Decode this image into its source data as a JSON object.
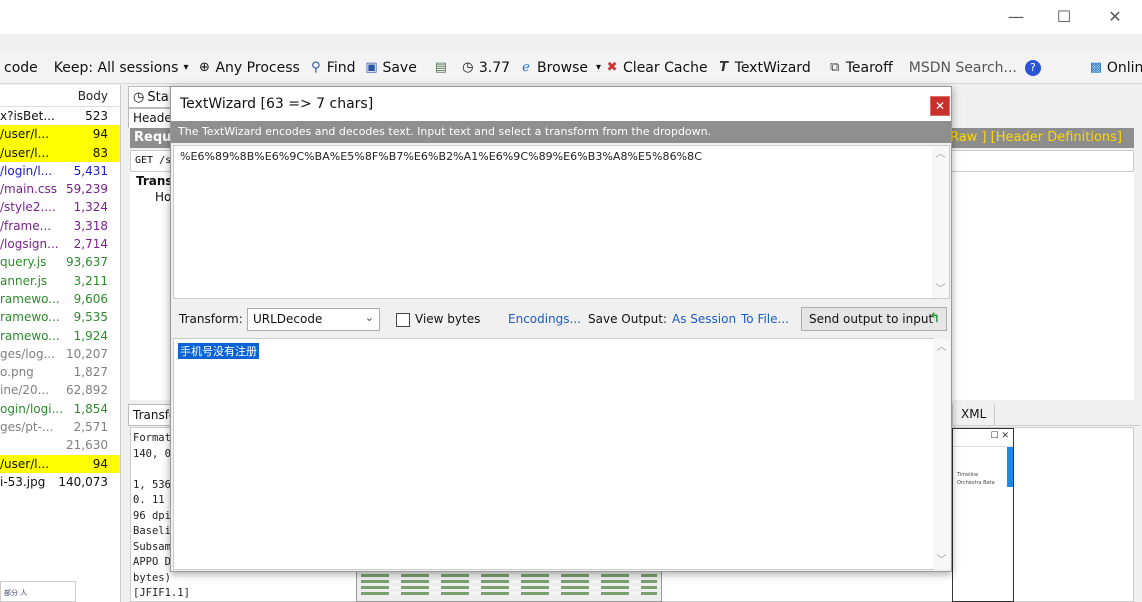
{
  "window": {
    "minimize": "—",
    "maximize": "☐",
    "close": "✕"
  },
  "toolbar": {
    "decode_label": "code",
    "keep_label": "Keep: All sessions",
    "process_label": "Any Process",
    "find_label": "Find",
    "save_label": "Save",
    "timer_label": "3.77",
    "browse_label": "Browse",
    "clear_cache_label": "Clear Cache",
    "textwizard_label": "TextWizard",
    "tearoff_label": "Tearoff",
    "msdn_label": "MSDN Search...",
    "online_label": "Online"
  },
  "sessions": {
    "body_header": "Body",
    "rows": [
      {
        "url": "x?isBet...",
        "body": "523",
        "color": "black",
        "hl": false
      },
      {
        "url": "/user/l...",
        "body": "94",
        "color": "black",
        "hl": true
      },
      {
        "url": "/user/l...",
        "body": "83",
        "color": "black",
        "hl": true
      },
      {
        "url": "/login/l...",
        "body": "5,431",
        "color": "blue",
        "hl": false
      },
      {
        "url": "/main.css",
        "body": "59,239",
        "color": "purple",
        "hl": false
      },
      {
        "url": "/style2....",
        "body": "1,324",
        "color": "purple",
        "hl": false
      },
      {
        "url": "/frame...",
        "body": "3,318",
        "color": "purple",
        "hl": false
      },
      {
        "url": "/logsign...",
        "body": "2,714",
        "color": "purple",
        "hl": false
      },
      {
        "url": "query.js",
        "body": "93,637",
        "color": "green",
        "hl": false
      },
      {
        "url": "anner.js",
        "body": "3,211",
        "color": "green",
        "hl": false
      },
      {
        "url": "ramewo...",
        "body": "9,606",
        "color": "green",
        "hl": false
      },
      {
        "url": "ramewo...",
        "body": "9,535",
        "color": "green",
        "hl": false
      },
      {
        "url": "ramewo...",
        "body": "1,924",
        "color": "green",
        "hl": false
      },
      {
        "url": "ges/log...",
        "body": "10,207",
        "color": "gray",
        "hl": false
      },
      {
        "url": "o.png",
        "body": "1,827",
        "color": "gray",
        "hl": false
      },
      {
        "url": "ine/20...",
        "body": "62,892",
        "color": "gray",
        "hl": false
      },
      {
        "url": "ogin/logi...",
        "body": "1,854",
        "color": "green",
        "hl": false
      },
      {
        "url": "ges/pt-...",
        "body": "2,571",
        "color": "gray",
        "hl": false
      },
      {
        "url": "",
        "body": "21,630",
        "color": "gray",
        "hl": false
      },
      {
        "url": "/user/l...",
        "body": "94",
        "color": "black",
        "hl": true
      },
      {
        "url": "i-53.jpg",
        "body": "140,073",
        "color": "black",
        "hl": false
      }
    ]
  },
  "inspector": {
    "stats_tab": "Sta",
    "headers_tab": "Header",
    "request_bar": "Requ",
    "request_links": "[ Raw ]   [Header Definitions]",
    "get_line": "GET /s",
    "transformer_label": "Trans",
    "host_label": "Ho",
    "transform_tab": "Transfo",
    "xml_tab": "XML",
    "response_text": "Format\n140, 07\n\n1, 536w\n0. 11 b\n96 dpi\nBaseli\nSubsam\nAPPO Data (14\nbytes)\n[JFIF1.1]",
    "mini_lines": [
      "Timeline",
      "Orchestra Beta"
    ],
    "tooltip_text": "部分 人"
  },
  "textwizard": {
    "title": "TextWizard [63 => 7 chars]",
    "close": "✕",
    "description": "The TextWizard encodes and decodes text. Input text and select a transform from the dropdown.",
    "input_text": "%E6%89%8B%E6%9C%BA%E5%8F%B7%E6%B2%A1%E6%9C%89%E6%B3%A8%E5%86%8C",
    "transform_label": "Transform:",
    "transform_value": "URLDecode",
    "view_bytes_label": "View bytes",
    "encodings_label": "Encodings...",
    "save_output_label": "Save Output:",
    "as_session_label": "As Session",
    "to_file_label": "To File...",
    "send_output_label": "Send output to input",
    "output_text": "手机号没有注册"
  }
}
